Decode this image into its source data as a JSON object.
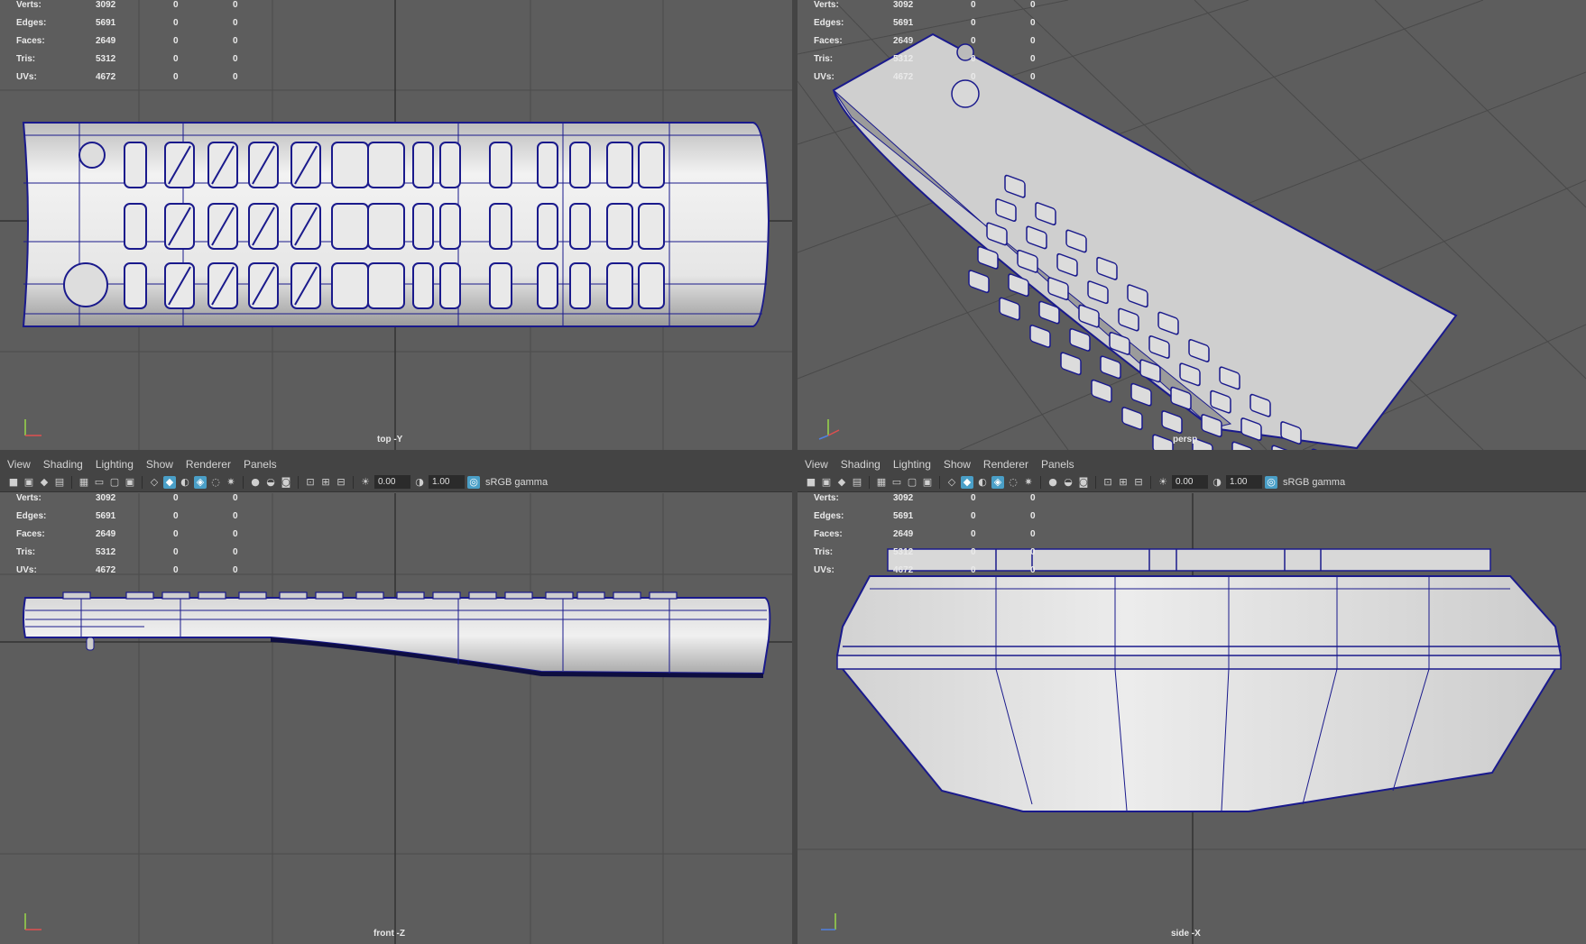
{
  "hud": {
    "rows": [
      {
        "label": "Verts:",
        "v1": "3092",
        "v2": "0",
        "v3": "0"
      },
      {
        "label": "Edges:",
        "v1": "5691",
        "v2": "0",
        "v3": "0"
      },
      {
        "label": "Faces:",
        "v1": "2649",
        "v2": "0",
        "v3": "0"
      },
      {
        "label": "Tris:",
        "v1": "5312",
        "v2": "0",
        "v3": "0"
      },
      {
        "label": "UVs:",
        "v1": "4672",
        "v2": "0",
        "v3": "0"
      }
    ]
  },
  "panes": {
    "top": {
      "camera": "top -Y"
    },
    "persp": {
      "camera": "persp"
    },
    "front": {
      "camera": "front -Z"
    },
    "side": {
      "camera": "side -X"
    }
  },
  "menu": {
    "view": "View",
    "shading": "Shading",
    "lighting": "Lighting",
    "show": "Show",
    "renderer": "Renderer",
    "panels": "Panels"
  },
  "toolbar": {
    "exposure": "0.00",
    "gamma_value": "1.00",
    "color_space": "sRGB gamma"
  },
  "colors": {
    "viewport_bg": "#5d5d5d",
    "grid": "#4a4a4a",
    "wire": "#1a1a8c",
    "highlight": "#4a9fc7"
  }
}
